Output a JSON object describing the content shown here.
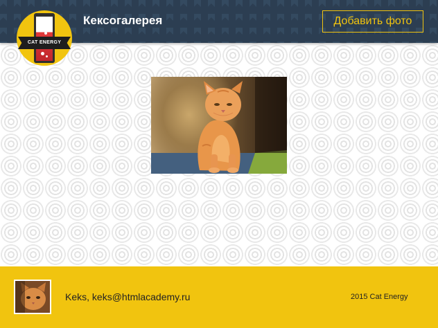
{
  "header": {
    "title": "Кексогалерея",
    "add_photo_label": "Добавить фото",
    "logo_text": "CAT ENERGY"
  },
  "gallery": {
    "photos": [
      {
        "subject": "orange tabby kitten"
      }
    ]
  },
  "footer": {
    "contact": "Keks, keks@htmlacademy.ru",
    "copyright": "2015 Cat Energy"
  },
  "colors": {
    "header_bg": "#2c3e52",
    "accent": "#f1c40f",
    "footer_bg": "#f1c40f"
  }
}
